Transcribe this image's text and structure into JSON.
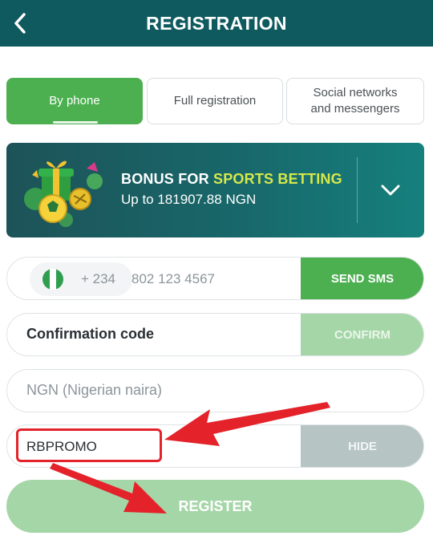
{
  "header": {
    "title": "REGISTRATION",
    "back_icon": "chevron-left-icon"
  },
  "tabs": [
    {
      "label": "By phone",
      "active": true
    },
    {
      "label": "Full registration",
      "active": false
    },
    {
      "label": "Social networks and messengers",
      "active": false
    }
  ],
  "bonus": {
    "title_prefix": "BONUS FOR ",
    "title_highlight": "SPORTS BETTING",
    "subtitle": "Up to 181907.88 NGN",
    "toggle_icon": "chevron-down-icon"
  },
  "phone": {
    "country_flag": "nigeria-flag-icon",
    "dial_code": "+ 234",
    "placeholder": "802 123 4567",
    "send_label": "SEND SMS"
  },
  "confirmation": {
    "label": "Confirmation code",
    "button": "CONFIRM"
  },
  "currency": {
    "value": "NGN (Nigerian naira)"
  },
  "promo": {
    "value": "RBPROMO",
    "button": "HIDE"
  },
  "register": {
    "label": "REGISTER"
  },
  "colors": {
    "header": "#0f5a5f",
    "accent_green": "#4caf50",
    "light_green": "#a5d6a7",
    "highlight_yellow": "#d6e84a",
    "annotation_red": "#e3222a"
  }
}
